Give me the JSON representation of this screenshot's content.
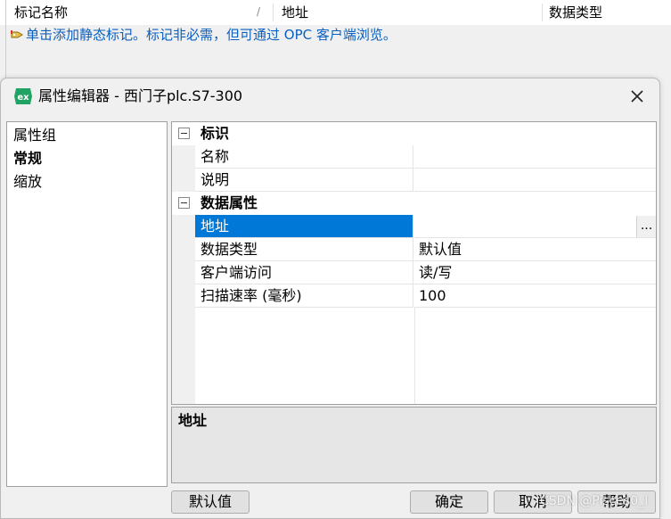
{
  "background": {
    "columns": [
      "标记名称",
      "地址",
      "数据类型"
    ],
    "hint": "单击添加静态标记。标记非必需，但可通过 OPC 客户端浏览。"
  },
  "dialog": {
    "app_icon_text": "ex",
    "title": "属性编辑器 - 西门子plc.S7-300",
    "left_items": [
      "属性组",
      "常规",
      "缩放"
    ],
    "categories": [
      {
        "label": "标识",
        "props": [
          {
            "name": "名称",
            "value": ""
          },
          {
            "name": "说明",
            "value": ""
          }
        ]
      },
      {
        "label": "数据属性",
        "props": [
          {
            "name": "地址",
            "value": "",
            "button": "..."
          },
          {
            "name": "数据类型",
            "value": "默认值"
          },
          {
            "name": "客户端访问",
            "value": "读/写"
          },
          {
            "name": "扫描速率 (毫秒)",
            "value": "100"
          }
        ]
      }
    ],
    "description_title": "地址",
    "buttons": {
      "default": "默认值",
      "ok": "确定",
      "cancel": "取消",
      "help": "帮助"
    }
  },
  "watermark": "CSDN @Pisces0_l",
  "colors": {
    "selection": "#0078d7",
    "hint_text": "#0b5fbf",
    "app_icon": "#21a366"
  }
}
